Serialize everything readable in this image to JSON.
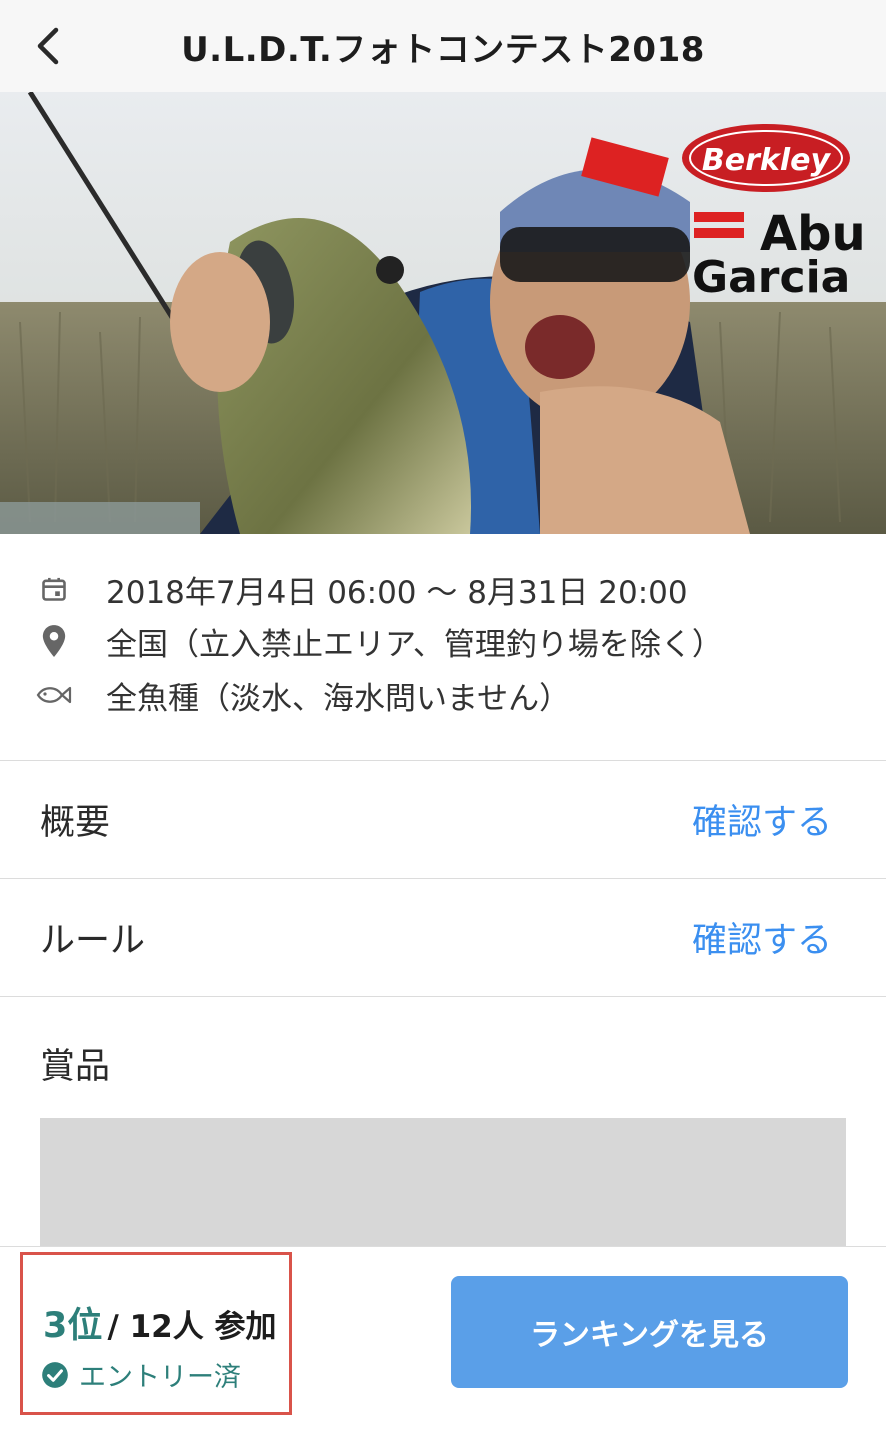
{
  "header": {
    "title": "U.L.D.T.フォトコンテスト2018",
    "back_icon": "chevron-left-icon"
  },
  "hero": {
    "logos": [
      "Berkley",
      "Abu",
      "Garcia"
    ]
  },
  "info": [
    {
      "icon": "calendar-icon",
      "text": "2018年7月4日 06:00 〜 8月31日 20:00"
    },
    {
      "icon": "location-pin-icon",
      "text": "全国（立入禁止エリア、管理釣り場を除く）"
    },
    {
      "icon": "fish-icon",
      "text": "全魚種（淡水、海水問いません）"
    }
  ],
  "sections": {
    "overview": {
      "label": "概要",
      "link": "確認する"
    },
    "rules": {
      "label": "ルール",
      "link": "確認する"
    },
    "prizes": {
      "label": "賞品"
    }
  },
  "footer": {
    "rank": "3位",
    "participants": "/ 12人 参加",
    "entry_status": "エントリー済",
    "ranking_button": "ランキングを見る"
  },
  "colors": {
    "accent_teal": "#2d7f7a",
    "link_blue": "#3b8ff0",
    "button_blue": "#5a9fe8",
    "highlight_red": "#d9534a"
  }
}
